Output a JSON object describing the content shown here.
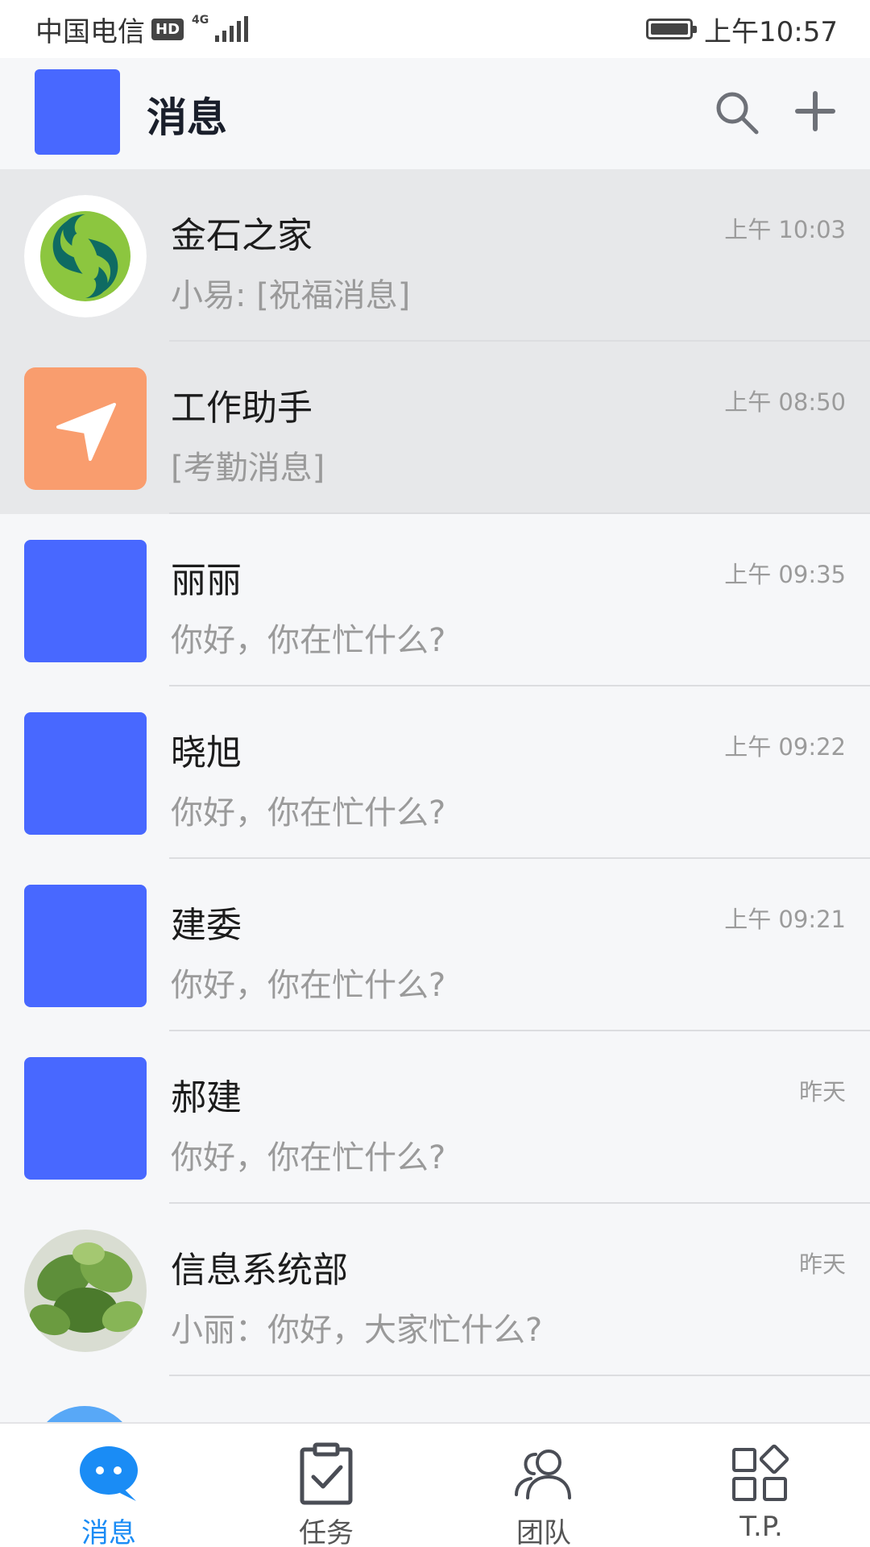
{
  "status_bar": {
    "carrier": "中国电信",
    "hd": "HD",
    "network": "4G",
    "time": "上午10:57",
    "battery_level": 1.0
  },
  "header": {
    "title": "消息"
  },
  "conversations": [
    {
      "name": "金石之家",
      "preview": "小易: [祝福消息]",
      "time": "上午 10:03",
      "avatar": "green-logo"
    },
    {
      "name": "工作助手",
      "preview": "[考勤消息]",
      "time": "上午 08:50",
      "avatar": "navigation-icon"
    },
    {
      "name": "丽丽",
      "preview": "你好，你在忙什么?",
      "time": "上午 09:35",
      "avatar": "blue-square"
    },
    {
      "name": "晓旭",
      "preview": "你好，你在忙什么?",
      "time": "上午 09:22",
      "avatar": "blue-square"
    },
    {
      "name": "建委",
      "preview": "你好，你在忙什么?",
      "time": "上午 09:21",
      "avatar": "blue-square"
    },
    {
      "name": "郝建",
      "preview": "你好，你在忙什么?",
      "time": "昨天",
      "avatar": "blue-square"
    },
    {
      "name": "信息系统部",
      "preview": "小丽：你好，大家忙什么?",
      "time": "昨天",
      "avatar": "plant-photo"
    }
  ],
  "nav": {
    "messages": "消息",
    "tasks": "任务",
    "team": "团队",
    "tp": "T.P."
  },
  "colors": {
    "accent": "#1a8cf5",
    "avatar_blue": "#4868ff",
    "assistant_orange": "#f99d6e",
    "pinned_bg": "#e7e8ea"
  }
}
